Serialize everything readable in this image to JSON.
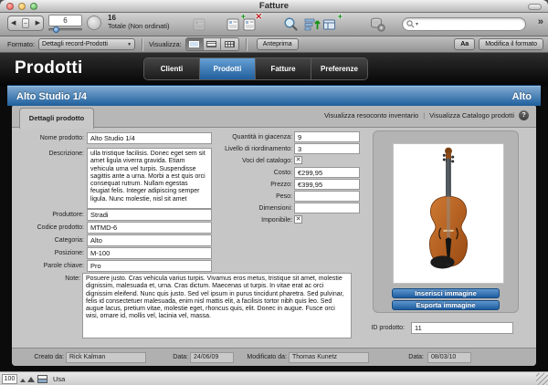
{
  "window": {
    "title": "Fatture"
  },
  "toolbar": {
    "record_slider_value": "6",
    "found_count": "16",
    "found_label": "Totale (Non ordinati)"
  },
  "format_bar": {
    "format_label": "Formato:",
    "format_value": "Dettagli record-Prodotti",
    "view_label": "Visualizza:",
    "preview_button": "Anteprima",
    "text_format_button": "Aa",
    "edit_layout_button": "Modifica il formato"
  },
  "nav_header": {
    "title": "Prodotti",
    "tabs": [
      {
        "label": "Clienti"
      },
      {
        "label": "Prodotti"
      },
      {
        "label": "Fatture"
      },
      {
        "label": "Preferenze"
      }
    ]
  },
  "record_bar": {
    "title": "Alto Studio 1/4",
    "category": "Alto"
  },
  "detail_panel": {
    "tab_label": "Dettagli prodotto",
    "link_inventory": "Visualizza resoconto inventario",
    "link_divider": "|",
    "link_catalog": "Visualizza Catalogo prodotti",
    "fields": {
      "nome": {
        "label": "Nome prodotto:",
        "value": "Alto Studio 1/4"
      },
      "descrizione": {
        "label": "Descrizione:",
        "value": "ulla tristique facilisis. Donec eget sem sit amet ligula viverra gravida. Etiam vehicula urna vel turpis. Suspendisse sagittis ante a urna. Morbi a est quis orci consequat rutrum. Nullam egestas feugiat felis. Integer adipiscing semper ligula. Nunc molestie, nisl sit amet"
      },
      "produttore": {
        "label": "Produttore:",
        "value": "Stradi"
      },
      "codice": {
        "label": "Codice prodotto:",
        "value": "MTMD-6"
      },
      "categoria": {
        "label": "Categoria:",
        "value": "Alto"
      },
      "posizione": {
        "label": "Posizione:",
        "value": "M-100"
      },
      "parole": {
        "label": "Parole chiave:",
        "value": "Pro"
      },
      "note": {
        "label": "Note:",
        "value": "Posuere justo. Cras vehicula varius turpis. Vivamus eros metus, tristique sit amet, molestie dignissim, malesuada et, urna.  Cras dictum. Maecenas ut turpis. In vitae erat ac orci dignissim eleifend. Nunc quis justo. Sed vel ipsum in purus tincidunt pharetra. Sed pulvinar, felis id consectetuer malesuada, enim nisl mattis elit, a facilisis tortor nibh quis leo. Sed augue lacus, pretium vitae, molestie eget, rhoncus quis, elit. Donec in augue. Fusce orci wisi, ornare id, mollis vel, lacinia vel, massa."
      },
      "quantita": {
        "label": "Quantità in giacenza:",
        "value": "9"
      },
      "livello": {
        "label": "Livello di riordinamento:",
        "value": "3"
      },
      "voci": {
        "label": "Voci del catalogo:",
        "checked": true
      },
      "costo": {
        "label": "Costo:",
        "value": "€299,95"
      },
      "prezzo": {
        "label": "Prezzo:",
        "value": "€399,95"
      },
      "peso": {
        "label": "Peso:",
        "value": ""
      },
      "dimensioni": {
        "label": "Dimensioni:",
        "value": ""
      },
      "imponibile": {
        "label": "Imponibile:",
        "checked": true
      },
      "id_prodotto": {
        "label": "ID prodotto:",
        "value": "11"
      }
    },
    "image_buttons": {
      "insert": "Inserisci immagine",
      "export": "Esporta immagine"
    }
  },
  "footer": {
    "created_label": "Creato da:",
    "created_value": "Rick Kalman",
    "created_date_label": "Data:",
    "created_date_value": "24/06/09",
    "modified_label": "Modificato da:",
    "modified_value": "Thomas Kunetz",
    "modified_date_label": "Data:",
    "modified_date_value": "08/03/10"
  },
  "status_bar": {
    "zoom_level": "100",
    "mode": "Usa"
  },
  "icons": {
    "back_arrow": "◀",
    "forward_arrow": "▶",
    "overflow_chevron": "»",
    "dropdown_arrow": "▼",
    "search_caret": "▾",
    "help_glyph": "?",
    "checkbox_mark": "✕",
    "add_badge": "+",
    "delete_badge": "✕"
  },
  "colors": {
    "accent_blue": "#2e76b5",
    "record_bar_top": "#7fa9d1",
    "record_bar_bottom": "#1e5f9c"
  }
}
